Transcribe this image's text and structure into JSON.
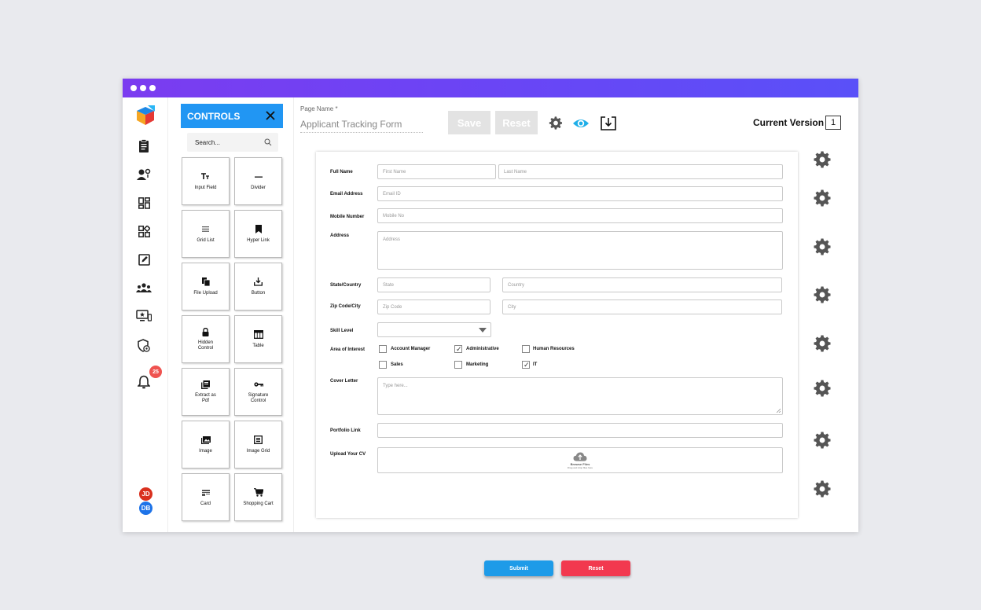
{
  "controls_panel": {
    "title": "CONTROLS",
    "search_placeholder": "Search...",
    "tiles": [
      {
        "label": "Input Field",
        "icon": "text-field-icon"
      },
      {
        "label": "Divider",
        "icon": "divider-icon"
      },
      {
        "label": "Grid List",
        "icon": "grid-list-icon"
      },
      {
        "label": "Hyper Link",
        "icon": "bookmark-icon"
      },
      {
        "label": "File Upload",
        "icon": "file-copy-icon"
      },
      {
        "label": "Button",
        "icon": "download-icon"
      },
      {
        "label": "Hidden Control",
        "icon": "lock-icon"
      },
      {
        "label": "Table",
        "icon": "table-icon"
      },
      {
        "label": "Extract as Pdf",
        "icon": "pdf-icon"
      },
      {
        "label": "Signature Control",
        "icon": "key-icon"
      },
      {
        "label": "Image",
        "icon": "image-icon"
      },
      {
        "label": "Image Grid",
        "icon": "image-grid-icon"
      },
      {
        "label": "Card",
        "icon": "card-icon"
      },
      {
        "label": "Shopping Cart",
        "icon": "cart-icon"
      }
    ]
  },
  "nav": {
    "notification_count": "25",
    "avatars": [
      "JD",
      "DB"
    ]
  },
  "header": {
    "page_name_label": "Page Name *",
    "page_name_value": "Applicant Tracking Form",
    "save_label": "Save",
    "reset_label": "Reset",
    "current_version_label": "Current Version",
    "current_version_value": "1"
  },
  "form": {
    "full_name_label": "Full Name",
    "first_name_placeholder": "First Name",
    "last_name_placeholder": "Last Name",
    "email_label": "Email Address",
    "email_placeholder": "Email ID",
    "mobile_label": "Mobile Number",
    "mobile_placeholder": "Mobile No",
    "address_label": "Address",
    "address_placeholder": "Address",
    "state_country_label": "State/Country",
    "state_placeholder": "State",
    "country_placeholder": "Country",
    "zip_city_label": "Zip Code/City",
    "zip_placeholder": "Zip Code",
    "city_placeholder": "City",
    "skill_label": "Skill Level",
    "skill_value": "",
    "interest_label": "Area of Interest",
    "interests": [
      {
        "label": "Account Manager",
        "checked": false
      },
      {
        "label": "Administrative",
        "checked": true
      },
      {
        "label": "Human Resources",
        "checked": false
      },
      {
        "label": "Sales",
        "checked": false
      },
      {
        "label": "Marketing",
        "checked": false
      },
      {
        "label": "IT",
        "checked": true
      }
    ],
    "cover_letter_label": "Cover Letter",
    "cover_letter_placeholder": "Type here...",
    "portfolio_label": "Portfolio Link",
    "portfolio_value": "",
    "upload_label": "Upload Your CV",
    "upload_title": "Browse Files",
    "upload_hint": "Drag and drop files here",
    "submit_label": "Submit",
    "reset_label": "Reset"
  },
  "colors": {
    "titlebar": "#6a45f5",
    "controls_header": "#2196f3",
    "submit": "#1e9be8",
    "reset": "#f2394f",
    "eye": "#1eaee8",
    "badge": "#ef5350",
    "avatar_jd": "#d9301e",
    "avatar_db": "#1e73e8"
  }
}
